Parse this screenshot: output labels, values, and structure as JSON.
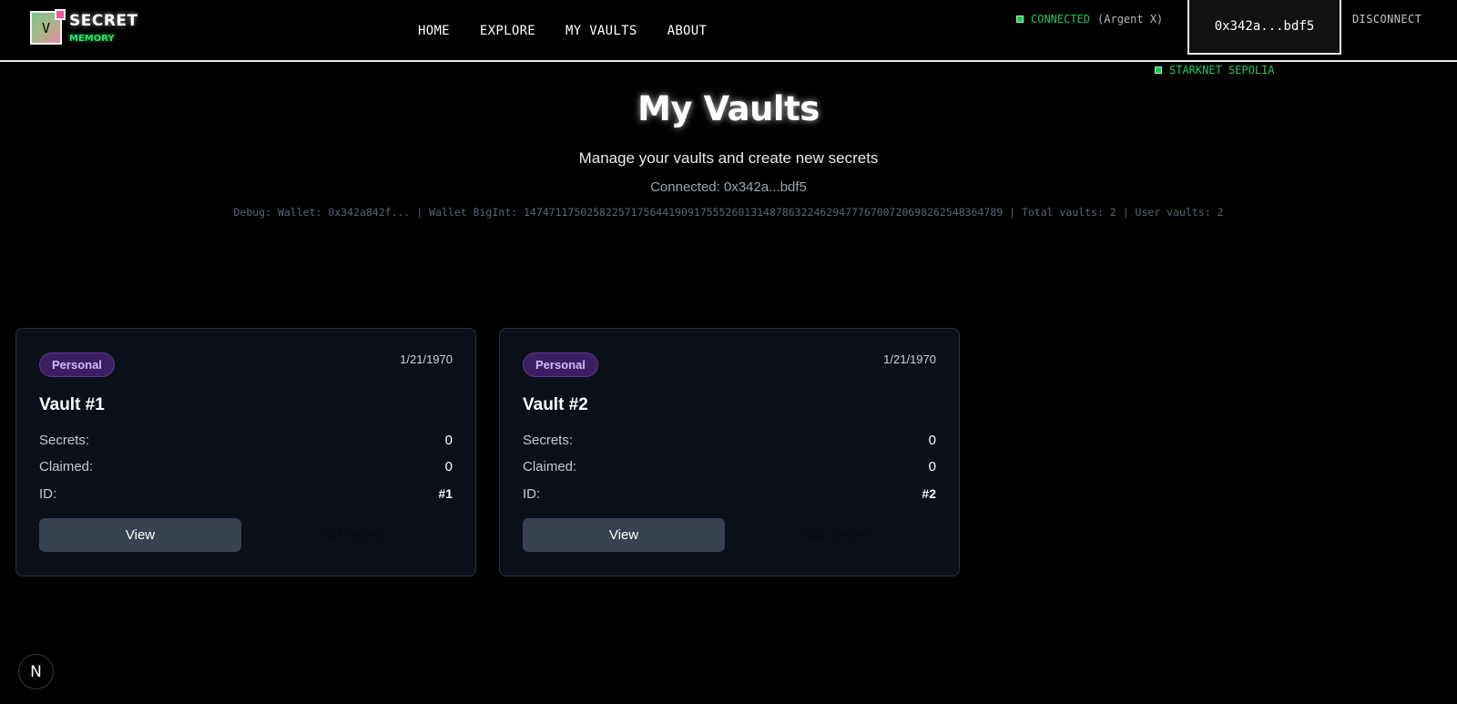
{
  "logo": {
    "letter": "V",
    "title": "SECRET",
    "subtitle": "MEMORY"
  },
  "nav": {
    "home": "HOME",
    "explore": "EXPLORE",
    "my_vaults": "MY VAULTS",
    "about": "ABOUT"
  },
  "wallet": {
    "status": "CONNECTED",
    "provider": "(Argent X)",
    "address_short": "0x342a...bdf5",
    "disconnect": "DISCONNECT",
    "network": "STARKNET SEPOLIA"
  },
  "page": {
    "title": "My Vaults",
    "subtitle": "Manage your vaults and create new secrets",
    "connected": "Connected: 0x342a...bdf5",
    "debug": "Debug: Wallet: 0x342a842f... | Wallet BigInt: 1474711750258225717564419091755526013148786322462947776700720698262548364789 | Total vaults: 2 | User vaults: 2"
  },
  "labels": {
    "secrets": "Secrets:",
    "claimed": "Claimed:",
    "id": "ID:",
    "view": "View",
    "add_secret": "Add Secret"
  },
  "vaults": [
    {
      "badge": "Personal",
      "date": "1/21/1970",
      "title": "Vault #1",
      "secrets": "0",
      "claimed": "0",
      "id": "#1"
    },
    {
      "badge": "Personal",
      "date": "1/21/1970",
      "title": "Vault #2",
      "secrets": "0",
      "claimed": "0",
      "id": "#2"
    }
  ],
  "dev_badge": "N",
  "colors": {
    "accent_green": "#22c55e",
    "badge_purple": "#3b1f63",
    "card_bg": "#0b0f17"
  }
}
